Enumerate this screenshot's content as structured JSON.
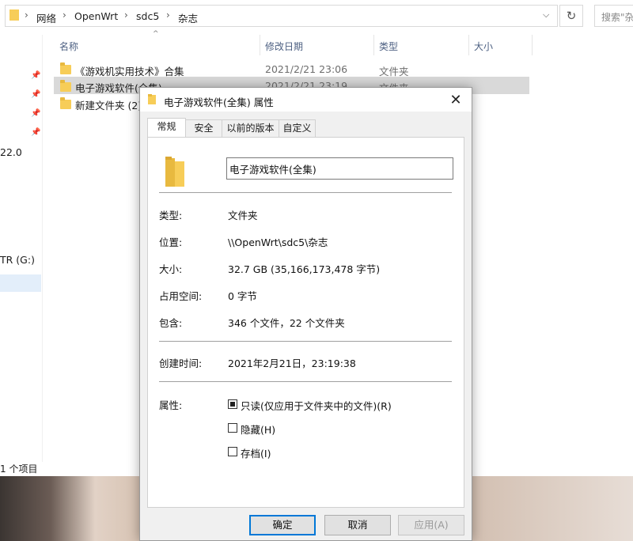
{
  "explorer": {
    "breadcrumb": [
      "网络",
      "OpenWrt",
      "sdc5",
      "杂志"
    ],
    "search_placeholder": "搜索\"杂",
    "columns": {
      "name": "名称",
      "modified": "修改日期",
      "type": "类型",
      "size": "大小"
    },
    "rows": [
      {
        "name": "《游戏机实用技术》合集",
        "modified": "2021/2/21 23:06",
        "type": "文件夹"
      },
      {
        "name": "电子游戏软件(全集)",
        "modified": "2021/2/21 23:19",
        "type": "文件夹"
      },
      {
        "name": "新建文件夹 (2)",
        "modified": "",
        "type": ""
      }
    ],
    "nav_fragments": {
      "a": "22.0",
      "b": "TR (G:)"
    },
    "status": "1 个项目"
  },
  "dialog": {
    "title": "电子游戏软件(全集) 属性",
    "tabs": [
      "常规",
      "安全",
      "以前的版本",
      "自定义"
    ],
    "name_value": "电子游戏软件(全集)",
    "properties": [
      {
        "label": "类型:",
        "value": "文件夹"
      },
      {
        "label": "位置:",
        "value": "\\\\OpenWrt\\sdc5\\杂志"
      },
      {
        "label": "大小:",
        "value": "32.7 GB (35,166,173,478 字节)"
      },
      {
        "label": "占用空间:",
        "value": "0 字节"
      },
      {
        "label": "包含:",
        "value": "346 个文件，22 个文件夹"
      }
    ],
    "created": {
      "label": "创建时间:",
      "value": "2021年2月21日，23:19:38"
    },
    "attributes": {
      "label": "属性:",
      "readonly": "只读(仅应用于文件夹中的文件)(R)",
      "hidden": "隐藏(H)",
      "archive": "存档(I)"
    },
    "buttons": {
      "ok": "确定",
      "cancel": "取消",
      "apply": "应用(A)"
    }
  },
  "colors": {
    "folder": "#f7cd58",
    "selection": "#d9d9d9",
    "accent": "#0078d7"
  }
}
